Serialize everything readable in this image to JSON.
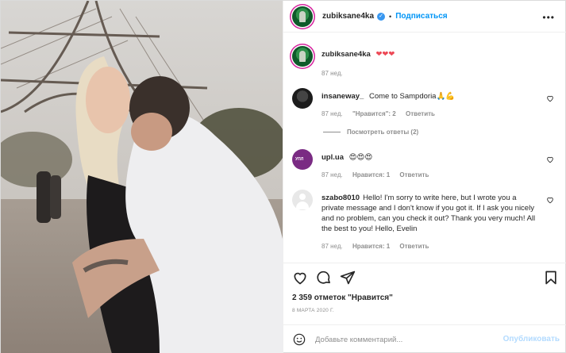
{
  "header": {
    "username": "zubiksane4ka",
    "follow_label": "Подписаться",
    "dot": "•"
  },
  "caption": {
    "username": "zubiksane4ka",
    "text": "❤❤❤",
    "time": "87 нед."
  },
  "comments": [
    {
      "username": "insaneway_",
      "text": "Come to Sampdoria🙏💪",
      "time": "87 нед.",
      "likes": "\"Нравится\": 2",
      "reply": "Ответить",
      "view_replies": "Посмотреть ответы (2)"
    },
    {
      "username": "upl.ua",
      "text": "😍😍😍",
      "time": "87 нед.",
      "likes": "Нравится: 1",
      "reply": "Ответить",
      "avatar_text": "УПЛ"
    },
    {
      "username": "szabo8010",
      "text": "Hello! I'm sorry to write here, but I wrote you a private message and I don't know if you got it. If I ask you nicely and no problem, can you check it out? Thank you very much! All the best to you! Hello, Evelin",
      "time": "87 нед.",
      "likes": "Нравится: 1",
      "reply": "Ответить"
    }
  ],
  "actions": {
    "likes_text": "2 359 отметок \"Нравится\"",
    "date": "8 МАРТА 2020 Г."
  },
  "add_comment": {
    "placeholder": "Добавьте комментарий...",
    "publish_label": "Опубликовать"
  },
  "colors": {
    "accent": "#0095f6",
    "publish_disabled": "#b3dbff",
    "muted": "#8e8e8e",
    "heart": "#ed4956"
  },
  "icons": [
    "more-icon",
    "verified-icon",
    "heart-icon",
    "comment-icon",
    "share-icon",
    "bookmark-icon",
    "emoji-icon"
  ]
}
